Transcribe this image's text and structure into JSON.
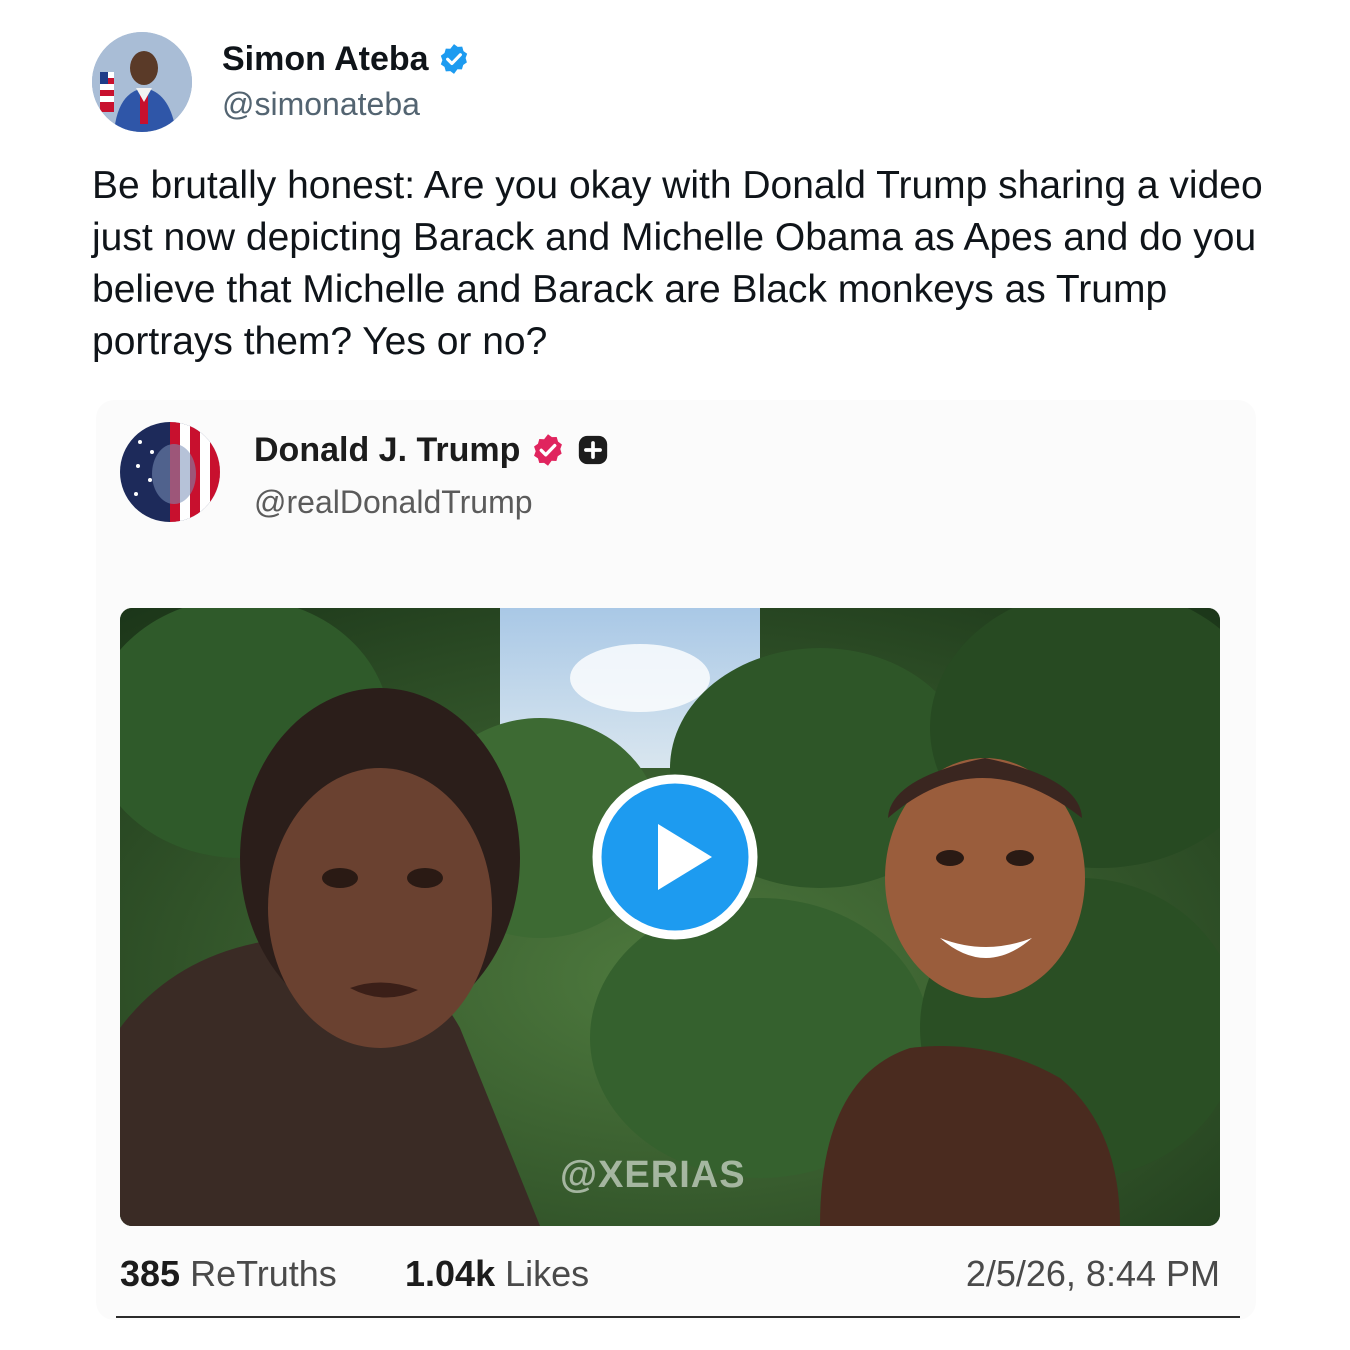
{
  "tweet": {
    "author_name": "Simon Ateba",
    "author_handle": "@simonateba",
    "text": "Be brutally honest: Are you okay with Donald Trump sharing a video just now depicting Barack and Michelle Obama as Apes and do you believe that Michelle and Barack are Black monkeys as Trump portrays them? Yes or no?",
    "verified_color": "#1d9bf0"
  },
  "embed": {
    "author_name": "Donald J. Trump",
    "author_handle": "@realDonaldTrump",
    "verified_color": "#e0245e",
    "watermark": "@XERIAS",
    "stats": {
      "retruths_count": "385",
      "retruths_label": "ReTruths",
      "likes_count": "1.04k",
      "likes_label": "Likes",
      "timestamp": "2/5/26, 8:44 PM"
    }
  },
  "icons": {
    "play": "play-icon",
    "verified": "verified-badge-icon",
    "plus": "plus-badge-icon"
  },
  "accent_color": "#1d9bf0"
}
